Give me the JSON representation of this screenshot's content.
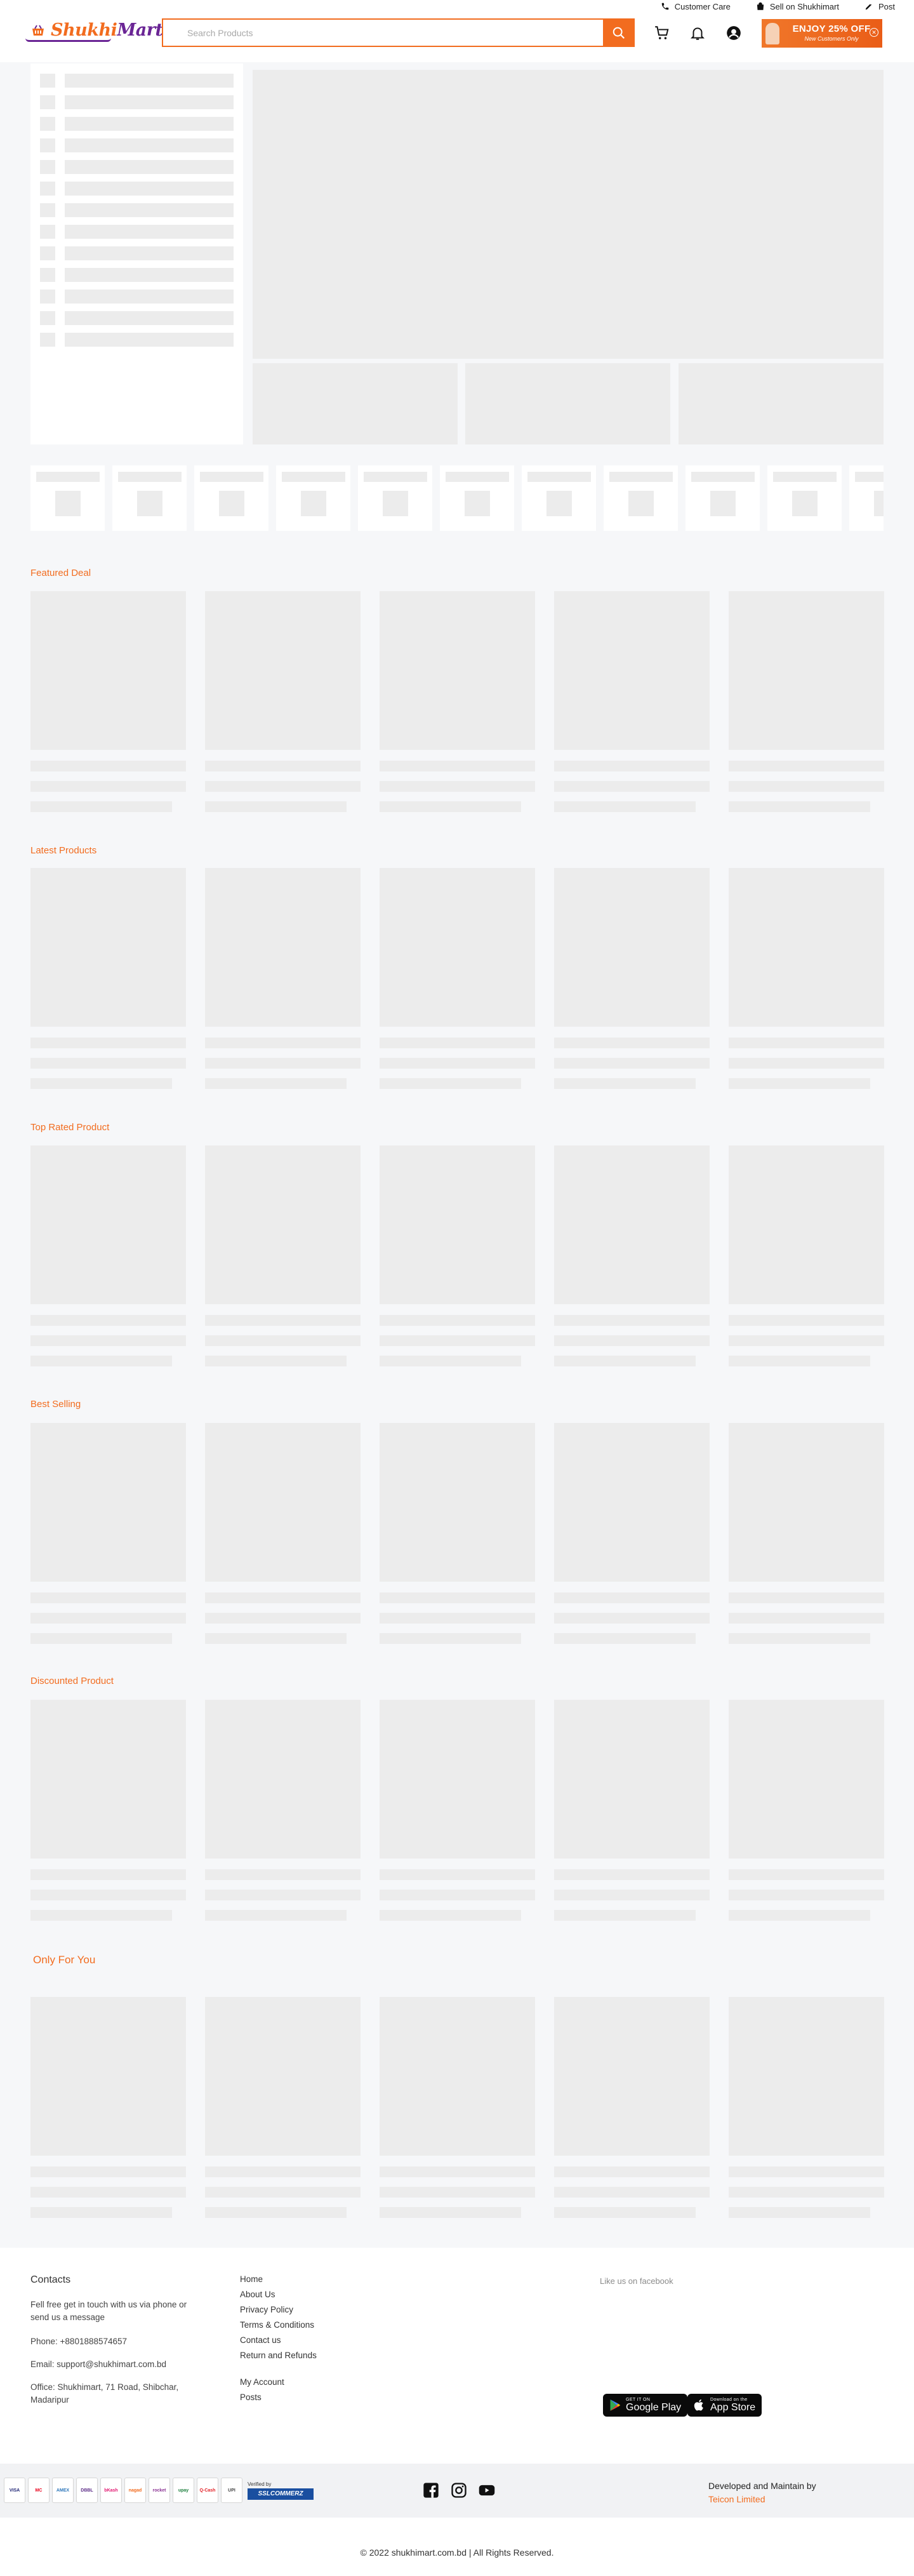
{
  "colors": {
    "accent": "#f26c1f",
    "brand_purple": "#6a2595",
    "skeleton": "#ececec"
  },
  "topbar": {
    "items": [
      {
        "label": "Customer Care",
        "icon": "phone-icon"
      },
      {
        "label": "Sell on Shukhimart",
        "icon": "shop-icon"
      },
      {
        "label": "Post",
        "icon": "post-icon"
      }
    ]
  },
  "header": {
    "logo": {
      "part1": "Shukhi",
      "part2": "Mart"
    },
    "search": {
      "placeholder": "Search Products",
      "value": ""
    },
    "icons": [
      "cart-icon",
      "bell-icon",
      "account-icon"
    ],
    "promo": {
      "title": "ENJOY 25% OFF",
      "subtitle": "New Customers Only"
    }
  },
  "sections": [
    {
      "title": "Featured Deal"
    },
    {
      "title": "Latest Products"
    },
    {
      "title": "Top Rated Product"
    },
    {
      "title": "Best Selling"
    },
    {
      "title": "Discounted Product"
    },
    {
      "title": "Only For You"
    }
  ],
  "footer": {
    "contact": {
      "heading": "Contacts",
      "intro": "Fell free get in touch with us via phone or send us a message",
      "phone": "Phone: +8801888574657",
      "email": "Email: support@shukhimart.com.bd",
      "office": "Office: Shukhimart, 71 Road, Shibchar, Madaripur"
    },
    "links": [
      "Home",
      "About Us",
      "Privacy Policy",
      "Terms & Conditions",
      "Contact us",
      "Return and Refunds"
    ],
    "links2": [
      "My Account",
      "Posts"
    ],
    "facebook_label": "Like us on facebook",
    "google_play": {
      "small": "GET IT ON",
      "big": "Google Play"
    },
    "app_store": {
      "small": "Download on the",
      "big": "App Store"
    },
    "payments": [
      "VISA",
      "MC",
      "AMEX",
      "DBBL",
      "bKash",
      "nagad",
      "rocket",
      "upay",
      "Q-Cash",
      "UPI"
    ],
    "ssl": {
      "small": "Verified by",
      "big": "SSLCOMMERZ"
    },
    "social": [
      "facebook-icon",
      "instagram-icon",
      "youtube-icon"
    ],
    "developer": {
      "line": "Developed and Maintain by",
      "company": "Teicon Limited"
    },
    "copyright": "© 2022 shukhimart.com.bd | All Rights Reserved."
  }
}
